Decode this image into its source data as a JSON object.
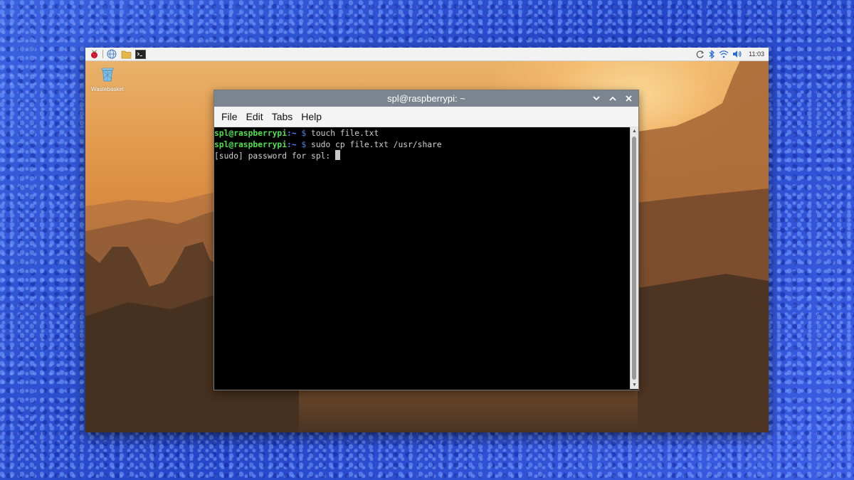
{
  "taskbar": {
    "icons": [
      "raspberry-menu-icon",
      "globe-icon",
      "folder-icon",
      "terminal-icon"
    ],
    "tray_icons": [
      "sync-icon",
      "bluetooth-icon",
      "wifi-icon",
      "volume-icon"
    ],
    "clock": "11:03"
  },
  "desktop": {
    "wastebasket_label": "Wastebasket"
  },
  "terminal": {
    "title": "spl@raspberrypi: ~",
    "menu": [
      "File",
      "Edit",
      "Tabs",
      "Help"
    ],
    "lines": [
      {
        "user": "spl@raspberrypi",
        "path": ":~",
        "dollar": " $",
        "cmd": " touch file.txt"
      },
      {
        "user": "spl@raspberrypi",
        "path": ":~",
        "dollar": " $",
        "cmd": " sudo cp file.txt /usr/share"
      }
    ],
    "sudo_prompt": "[sudo] password for spl: "
  },
  "colors": {
    "prompt_user": "#4fe04a",
    "prompt_path": "#5a7cf0",
    "titlebar": "#7c858f"
  }
}
